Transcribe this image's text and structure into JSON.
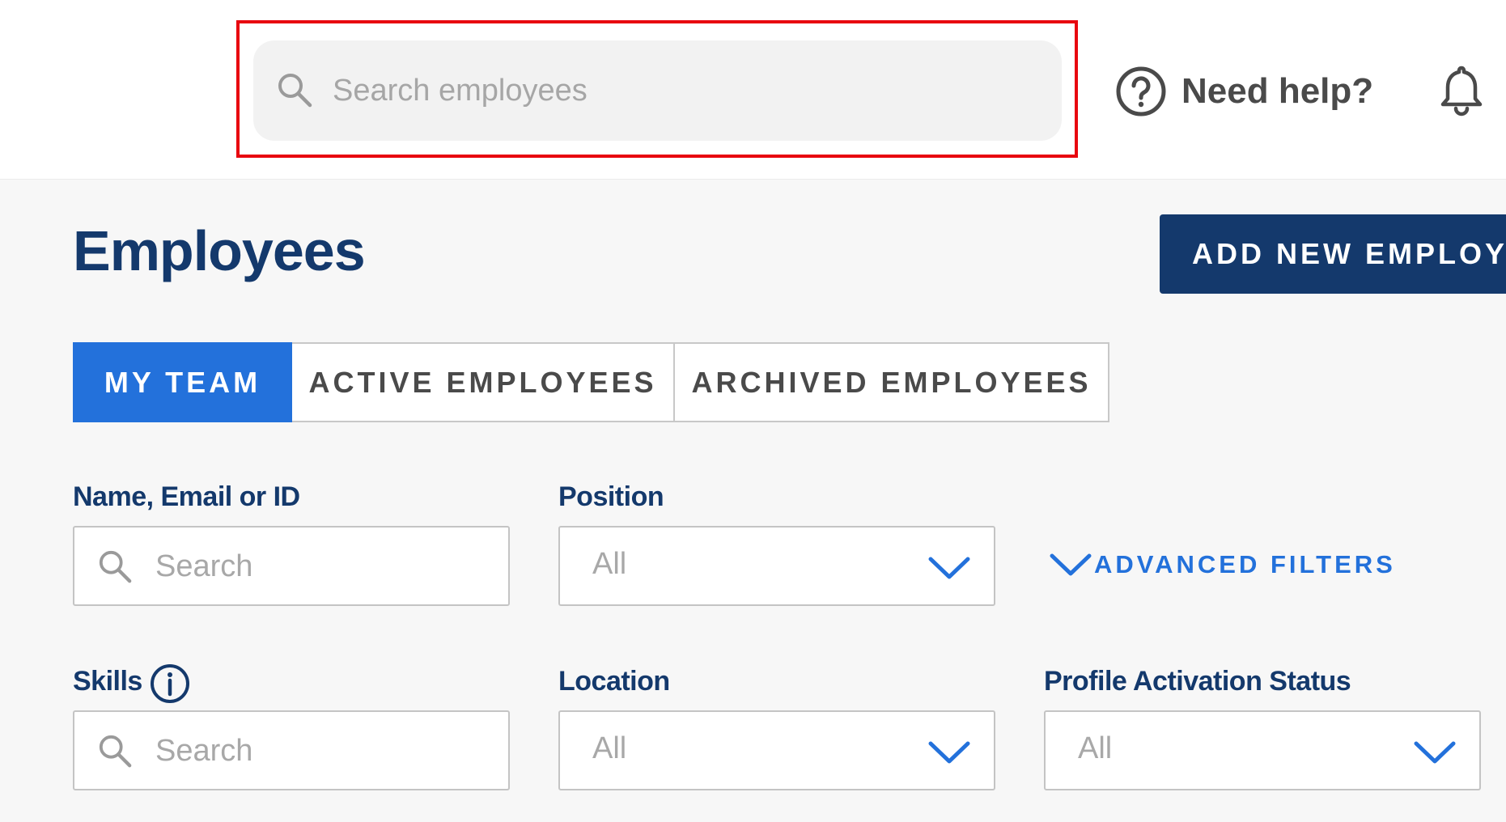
{
  "header": {
    "search_placeholder": "Search employees",
    "help_label": "Need help?"
  },
  "page": {
    "title": "Employees",
    "add_button_label": "ADD NEW EMPLOYEE"
  },
  "tabs": [
    {
      "label": "MY TEAM",
      "active": true
    },
    {
      "label": "ACTIVE EMPLOYEES",
      "active": false
    },
    {
      "label": "ARCHIVED EMPLOYEES",
      "active": false
    }
  ],
  "filters": {
    "name": {
      "label": "Name, Email or ID",
      "placeholder": "Search"
    },
    "position": {
      "label": "Position",
      "value": "All"
    },
    "advanced_label": "ADVANCED FILTERS",
    "skills": {
      "label": "Skills",
      "placeholder": "Search"
    },
    "location": {
      "label": "Location",
      "value": "All"
    },
    "profile_status": {
      "label": "Profile Activation Status",
      "value": "All"
    }
  },
  "icons": {
    "search": "search-icon",
    "help": "help-circle-icon",
    "bell": "bell-icon",
    "chevron": "chevron-down-icon",
    "info": "info-icon"
  },
  "colors": {
    "brand_navy": "#14396c",
    "accent_blue": "#2371db",
    "highlight_red": "#e8060f"
  }
}
